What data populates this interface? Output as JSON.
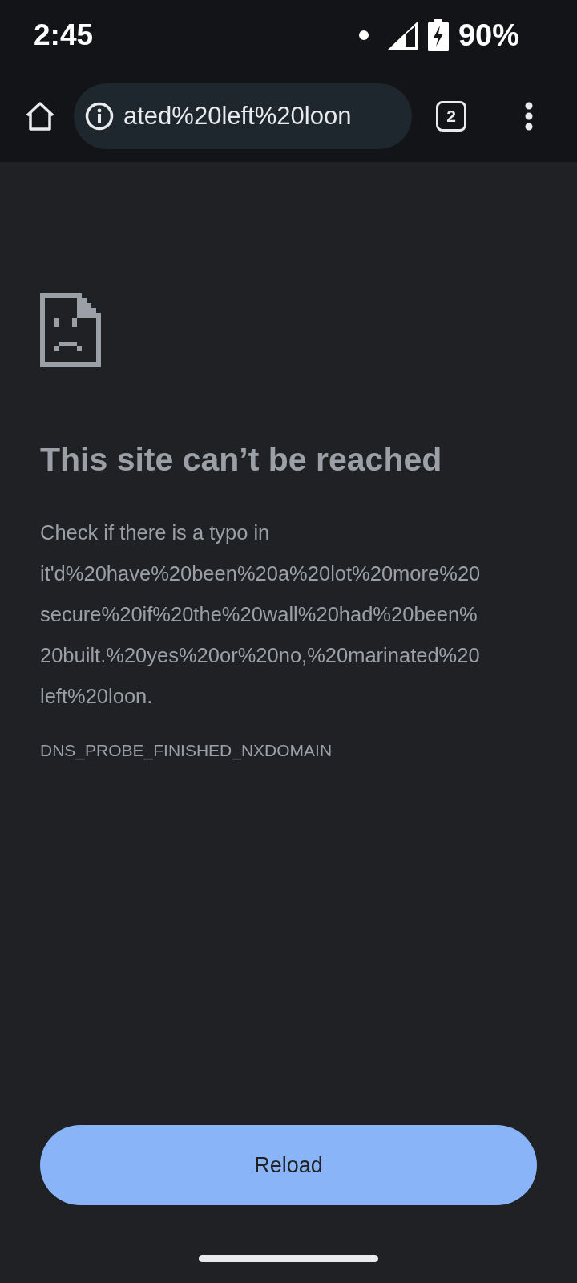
{
  "status_bar": {
    "time": "2:45",
    "battery": "90%"
  },
  "toolbar": {
    "url": "ated%20left%20loon",
    "tab_count": "2"
  },
  "error_page": {
    "title": "This site can’t be reached",
    "message_lines": [
      "Check if there is a typo in",
      "it'd%20have%20been%20a%20lot%20more%20",
      "secure%20if%20the%20wall%20had%20been%",
      "20built.%20yes%20or%20no,%20marinated%20",
      "left%20loon."
    ],
    "error_code": "DNS_PROBE_FINISHED_NXDOMAIN",
    "button": "Reload"
  }
}
